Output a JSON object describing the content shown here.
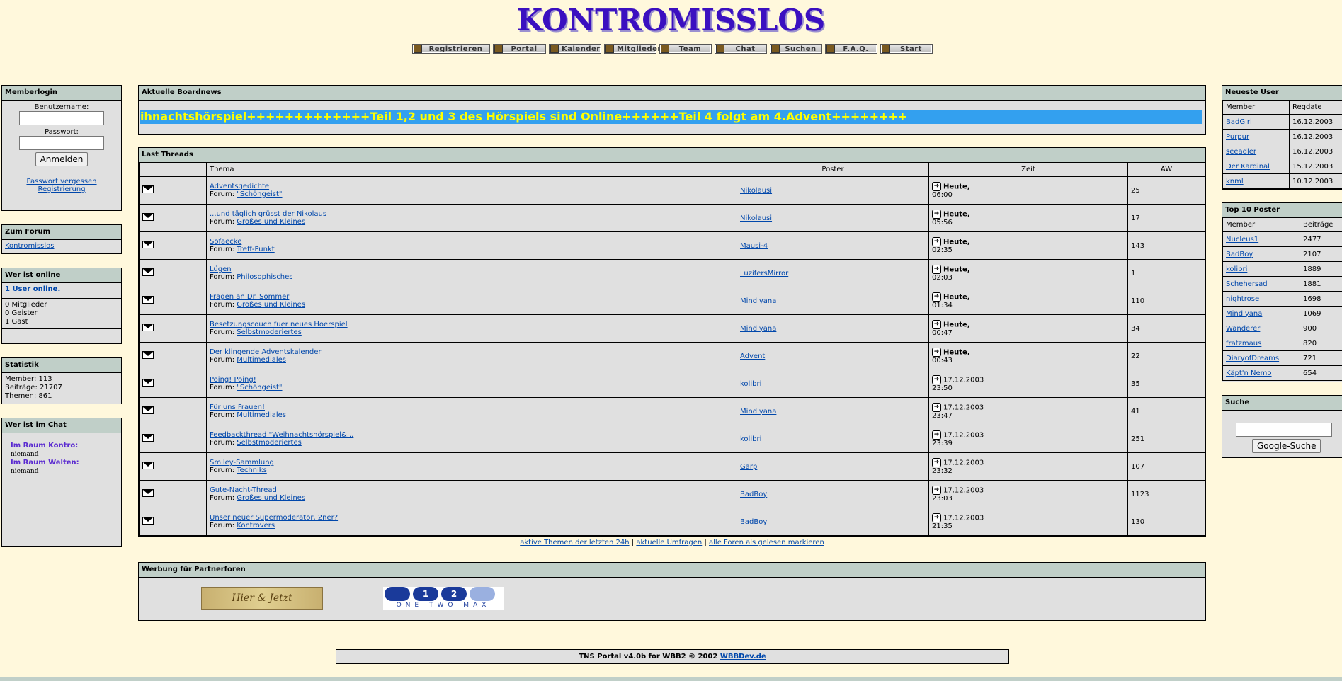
{
  "header": {
    "title": "KONTROMISSLOS"
  },
  "nav": [
    {
      "label": "Registrieren",
      "icon": "register-icon"
    },
    {
      "label": "Portal",
      "icon": "portal-icon"
    },
    {
      "label": "Kalender",
      "icon": "calendar-icon"
    },
    {
      "label": "Mitglieder",
      "icon": "members-icon"
    },
    {
      "label": "Team",
      "icon": "team-icon"
    },
    {
      "label": "Chat",
      "icon": "chat-icon"
    },
    {
      "label": "Suchen",
      "icon": "search-icon"
    },
    {
      "label": "F.A.Q.",
      "icon": "help-icon"
    },
    {
      "label": "Start",
      "icon": "home-icon"
    }
  ],
  "login": {
    "title": "Memberlogin",
    "username_label": "Benutzername:",
    "password_label": "Passwort:",
    "submit": "Anmelden",
    "forgot": "Passwort vergessen",
    "register": "Registrierung"
  },
  "forum": {
    "title": "Zum Forum",
    "link": "Kontromisslos"
  },
  "online": {
    "title": "Wer ist online",
    "link": "1 User online.",
    "members": "0 Mitglieder",
    "ghosts": "0 Geister",
    "guests": "1 Gast"
  },
  "stats": {
    "title": "Statistik",
    "members": "Member: 113",
    "posts": "Beiträge: 21707",
    "threads": "Themen: 861"
  },
  "chat": {
    "title": "Wer ist im Chat",
    "room1": "Im Raum Kontro:",
    "room1_user": "niemand",
    "room2": "Im Raum Welten:",
    "room2_user": "niemand"
  },
  "news": {
    "title": "Aktuelle Boardnews",
    "ticker": "ihnachtshörspiel+++++++++++++Teil 1,2 und 3 des Hörspiels sind Online++++++Teil 4 folgt am 4.Advent++++++++"
  },
  "threads": {
    "title": "Last Threads",
    "columns": [
      "Thema",
      "Poster",
      "Zeit",
      "AW"
    ],
    "forum_prefix": "Forum:",
    "rows": [
      {
        "title": "Adventsgedichte",
        "forum": "\"Schöngeist\"",
        "poster": "Nikolausi",
        "date": "Heute,",
        "time": "06:00",
        "aw": "25"
      },
      {
        "title": "...und täglich grüsst der Nikolaus",
        "forum": "Großes und Kleines",
        "poster": "Nikolausi",
        "date": "Heute,",
        "time": "05:56",
        "aw": "17"
      },
      {
        "title": "Sofaecke",
        "forum": "Treff-Punkt",
        "poster": "Mausi-4",
        "date": "Heute,",
        "time": "02:35",
        "aw": "143"
      },
      {
        "title": "Lügen",
        "forum": "Philosophisches",
        "poster": "LuzifersMirror",
        "date": "Heute,",
        "time": "02:03",
        "aw": "1"
      },
      {
        "title": "Fragen an Dr. Sommer",
        "forum": "Großes und Kleines",
        "poster": "Mindiyana",
        "date": "Heute,",
        "time": "01:34",
        "aw": "110"
      },
      {
        "title": "Besetzungscouch fuer neues Hoerspiel",
        "forum": "Selbstmoderiertes",
        "poster": "Mindiyana",
        "date": "Heute,",
        "time": "00:47",
        "aw": "34"
      },
      {
        "title": "Der klingende Adventskalender",
        "forum": "Multimediales",
        "poster": "Advent",
        "date": "Heute,",
        "time": "00:43",
        "aw": "22"
      },
      {
        "title": "Poing! Poing!",
        "forum": "\"Schöngeist\"",
        "poster": "kolibri",
        "date": "17.12.2003",
        "time": "23:50",
        "aw": "35"
      },
      {
        "title": "Für uns Frauen!",
        "forum": "Multimediales",
        "poster": "Mindiyana",
        "date": "17.12.2003",
        "time": "23:47",
        "aw": "41"
      },
      {
        "title": "Feedbackthread \"Weihnachtshörspiel&...",
        "forum": "Selbstmoderiertes",
        "poster": "kolibri",
        "date": "17.12.2003",
        "time": "23:39",
        "aw": "251"
      },
      {
        "title": "Smiley-Sammlung",
        "forum": "Techniks",
        "poster": "Garp",
        "date": "17.12.2003",
        "time": "23:32",
        "aw": "107"
      },
      {
        "title": "Gute-Nacht-Thread",
        "forum": "Großes und Kleines",
        "poster": "BadBoy",
        "date": "17.12.2003",
        "time": "23:03",
        "aw": "1123"
      },
      {
        "title": "Unser neuer Supermoderator, 2ner?",
        "forum": "Kontrovers",
        "poster": "BadBoy",
        "date": "17.12.2003",
        "time": "21:35",
        "aw": "130"
      }
    ]
  },
  "links": {
    "active": "aktive Themen der letzten 24h",
    "polls": "aktuelle Umfragen",
    "markread": "alle Foren als gelesen markieren",
    "sep": "|"
  },
  "partners": {
    "title": "Werbung für Partnerforen",
    "banner1": "Hier & Jetzt",
    "banner2": "ONE TWO MAX"
  },
  "newest": {
    "title": "Neueste User",
    "col_member": "Member",
    "col_date": "Regdate",
    "rows": [
      {
        "name": "BadGirl",
        "date": "16.12.2003"
      },
      {
        "name": "Purpur",
        "date": "16.12.2003"
      },
      {
        "name": "seeadler",
        "date": "16.12.2003"
      },
      {
        "name": "Der Kardinal",
        "date": "15.12.2003"
      },
      {
        "name": "knml",
        "date": "10.12.2003"
      }
    ]
  },
  "top10": {
    "title": "Top 10 Poster",
    "col_member": "Member",
    "col_posts": "Beiträge",
    "rows": [
      {
        "name": "Nucleus1",
        "posts": "2477"
      },
      {
        "name": "BadBoy",
        "posts": "2107"
      },
      {
        "name": "kolibri",
        "posts": "1889"
      },
      {
        "name": "Schehersad",
        "posts": "1881"
      },
      {
        "name": "nightrose",
        "posts": "1698"
      },
      {
        "name": "Mindiyana",
        "posts": "1069"
      },
      {
        "name": "Wanderer",
        "posts": "900"
      },
      {
        "name": "fratzmaus",
        "posts": "820"
      },
      {
        "name": "DiaryofDreams",
        "posts": "721"
      },
      {
        "name": "Käpt'n Nemo",
        "posts": "654"
      }
    ]
  },
  "search": {
    "title": "Suche",
    "button": "Google-Suche"
  },
  "footer": {
    "text": "TNS Portal v4.0b for WBB2 © 2002 ",
    "link": "WBBDev.de"
  }
}
